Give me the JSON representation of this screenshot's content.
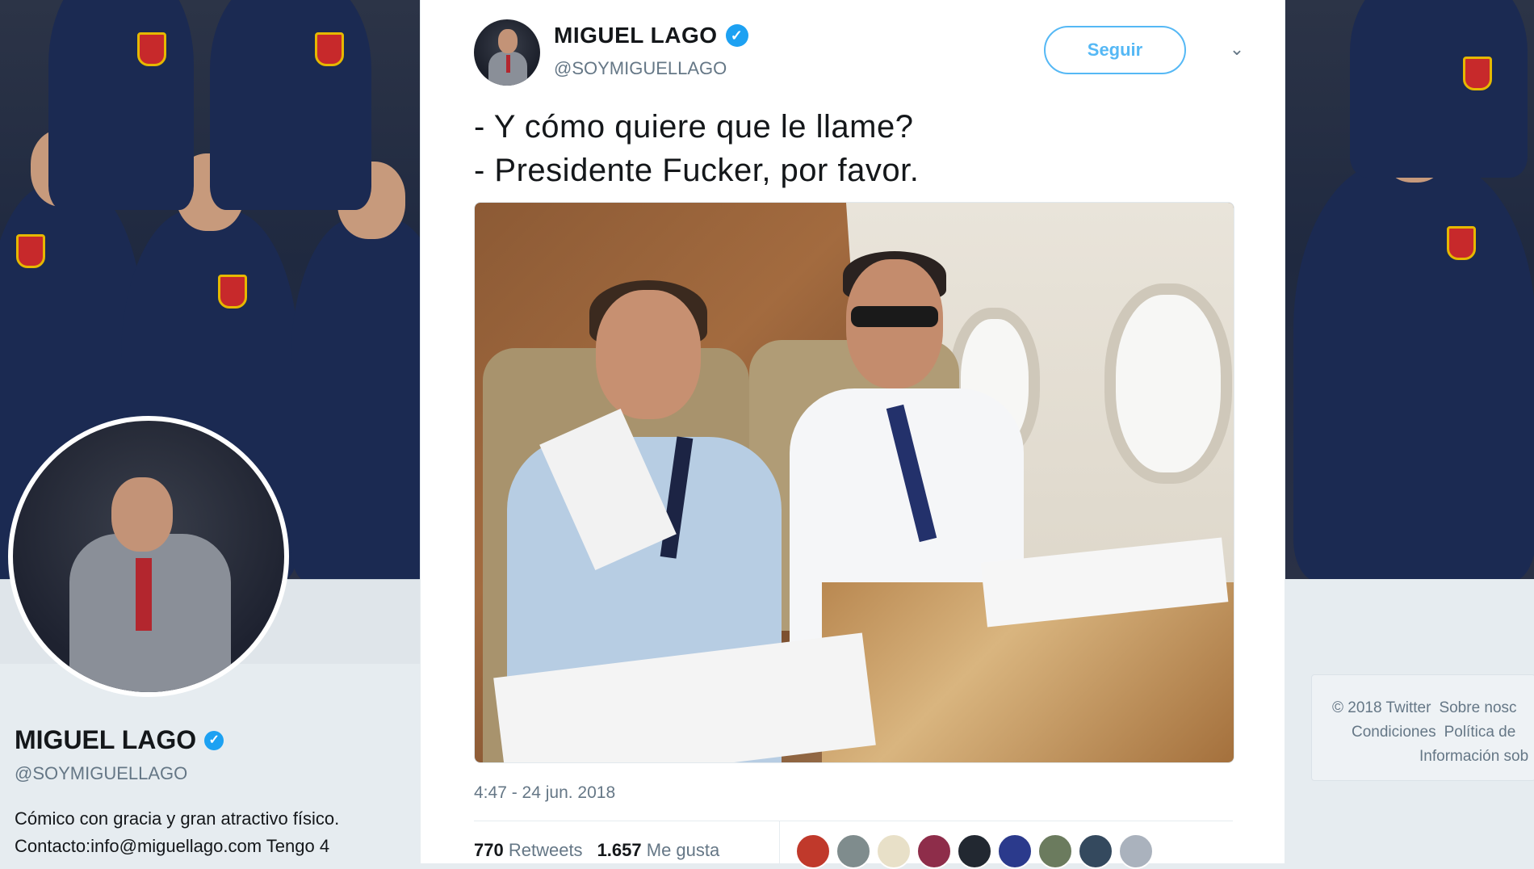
{
  "profile": {
    "name": "MIGUEL LAGO",
    "handle": "@SOYMIGUELLAGO",
    "bio_line1": "Cómico con gracia y gran atractivo físico.",
    "bio_line2": "Contacto:info@miguellago.com Tengo 4"
  },
  "tweet": {
    "author_name": "MIGUEL LAGO",
    "author_handle": "@SOYMIGUELLAGO",
    "follow_label": "Seguir",
    "text": "- Y cómo quiere que le llame?\n- Presidente Fucker, por favor.",
    "timestamp": "4:47 - 24 jun. 2018",
    "retweets_count": "770",
    "retweets_label": "Retweets",
    "likes_count": "1.657",
    "likes_label": "Me gusta",
    "liker_colors": [
      "#c0392b",
      "#7f8c8d",
      "#e8e0c8",
      "#8e2d4a",
      "#222831",
      "#2b3a8c",
      "#6b7b5e",
      "#34495e",
      "#aab2bd"
    ]
  },
  "footer": {
    "row1": [
      "© 2018 Twitter",
      "Sobre nosc"
    ],
    "row2": [
      "Condiciones",
      "Política de"
    ],
    "row3": [
      "Información sob"
    ]
  },
  "colors": {
    "accent": "#1da1f2",
    "muted": "#657786"
  }
}
